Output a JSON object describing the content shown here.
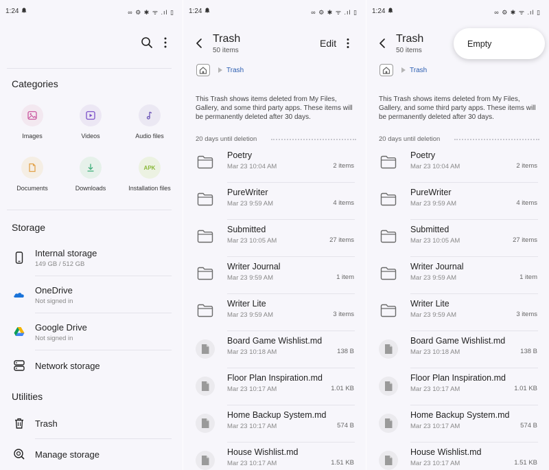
{
  "status": {
    "time": "1:24",
    "icons": "∞ ⚙ ✱ ᯤ .ıl ▯"
  },
  "home": {
    "categories_title": "Categories",
    "categories": [
      {
        "label": "Images",
        "icon": "image-icon",
        "color": "#c9549e",
        "bg": "#f3e8f0"
      },
      {
        "label": "Videos",
        "icon": "video-icon",
        "color": "#7b4fc9",
        "bg": "#ece7f4"
      },
      {
        "label": "Audio files",
        "icon": "music-icon",
        "color": "#6d56b8",
        "bg": "#ebe8f3"
      },
      {
        "label": "Documents",
        "icon": "document-icon",
        "color": "#e2a24a",
        "bg": "#f5eee4"
      },
      {
        "label": "Downloads",
        "icon": "download-icon",
        "color": "#3fae7a",
        "bg": "#e6f1ea"
      },
      {
        "label": "Installation files",
        "icon": "apk-icon",
        "apk_text": "APK",
        "color": "#8ab83a",
        "bg": "#ecf2e2"
      }
    ],
    "storage_title": "Storage",
    "storage": [
      {
        "title": "Internal storage",
        "sub": "149 GB / 512 GB",
        "icon": "phone-icon"
      },
      {
        "title": "OneDrive",
        "sub": "Not signed in",
        "icon": "onedrive-icon"
      },
      {
        "title": "Google Drive",
        "sub": "Not signed in",
        "icon": "google-drive-icon"
      },
      {
        "title": "Network storage",
        "sub": "",
        "icon": "network-storage-icon"
      }
    ],
    "utilities_title": "Utilities",
    "utilities": [
      {
        "title": "Trash",
        "icon": "trash-icon"
      },
      {
        "title": "Manage storage",
        "icon": "manage-storage-icon"
      }
    ]
  },
  "trash": {
    "title": "Trash",
    "count": "50 items",
    "edit_label": "Edit",
    "breadcrumb": "Trash",
    "info": "This Trash shows items deleted from My Files, Gallery, and some third party apps. These items will be permanently deleted after 30 days.",
    "days_label": "20 days until deletion",
    "items": [
      {
        "name": "Poetry",
        "date": "Mar 23 10:04 AM",
        "size": "2 items",
        "type": "folder"
      },
      {
        "name": "PureWriter",
        "date": "Mar 23 9:59 AM",
        "size": "4 items",
        "type": "folder"
      },
      {
        "name": "Submitted",
        "date": "Mar 23 10:05 AM",
        "size": "27 items",
        "type": "folder"
      },
      {
        "name": "Writer Journal",
        "date": "Mar 23 9:59 AM",
        "size": "1 item",
        "type": "folder"
      },
      {
        "name": "Writer Lite",
        "date": "Mar 23 9:59 AM",
        "size": "3 items",
        "type": "folder"
      },
      {
        "name": "Board Game Wishlist.md",
        "date": "Mar 23 10:18 AM",
        "size": "138 B",
        "type": "file"
      },
      {
        "name": "Floor Plan Inspiration.md",
        "date": "Mar 23 10:17 AM",
        "size": "1.01 KB",
        "type": "file"
      },
      {
        "name": "Home Backup System.md",
        "date": "Mar 23 10:17 AM",
        "size": "574 B",
        "type": "file"
      },
      {
        "name": "House Wishlist.md",
        "date": "Mar 23 10:17 AM",
        "size": "1.51 KB",
        "type": "file"
      }
    ],
    "popup_label": "Empty"
  }
}
